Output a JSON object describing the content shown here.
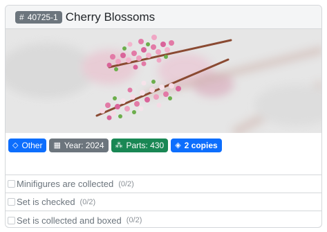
{
  "card": {
    "set_number": "40725-1",
    "set_icon": "hash-icon",
    "title": "Cherry Blossoms",
    "image_alt": "Cherry Blossoms set image"
  },
  "badges": [
    {
      "icon": "tag-icon",
      "label": "Other"
    },
    {
      "icon": "calendar-icon",
      "label": "Year: 2024"
    },
    {
      "icon": "parts-icon",
      "label": "Parts: 430"
    },
    {
      "icon": "stack-icon",
      "label": "2 copies"
    }
  ],
  "checks": [
    {
      "label": "Minifigures are collected",
      "count": "(0/2)"
    },
    {
      "label": "Set is checked",
      "count": "(0/2)"
    },
    {
      "label": "Set is collected and boxed",
      "count": "(0/2)"
    }
  ],
  "colors": {
    "primary": "#0d6efd",
    "secondary": "#6c757d",
    "success": "#198754",
    "blossom": "#e98fb3"
  }
}
